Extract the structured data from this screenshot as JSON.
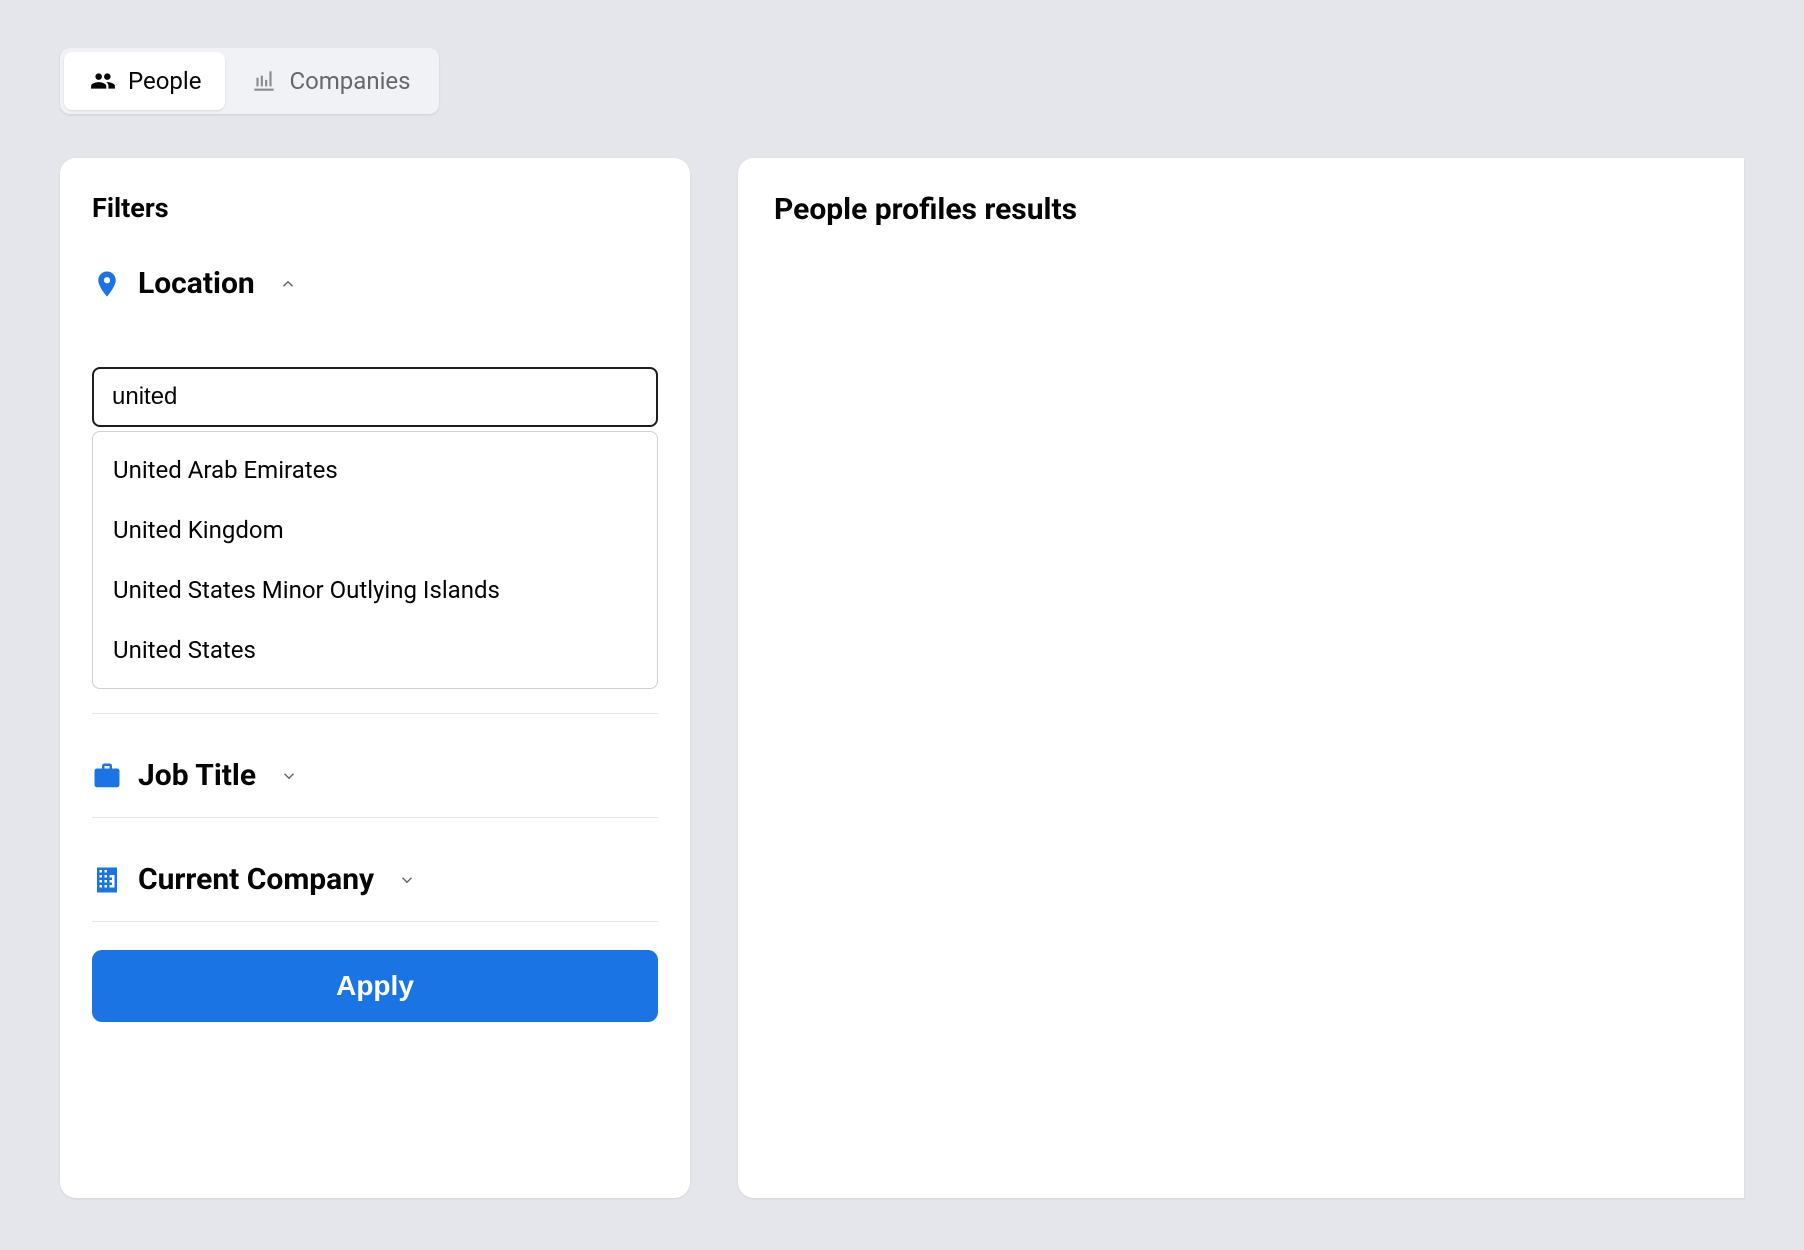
{
  "tabs": {
    "people": "People",
    "companies": "Companies"
  },
  "sidebar": {
    "title": "Filters",
    "location": {
      "label": "Location",
      "input_value": "united",
      "suggestions": [
        "United Arab Emirates",
        "United Kingdom",
        "United States Minor Outlying Islands",
        "United States"
      ]
    },
    "job_title": {
      "label": "Job Title"
    },
    "current_company": {
      "label": "Current Company"
    },
    "apply_label": "Apply"
  },
  "main": {
    "results_title": "People profiles results"
  }
}
